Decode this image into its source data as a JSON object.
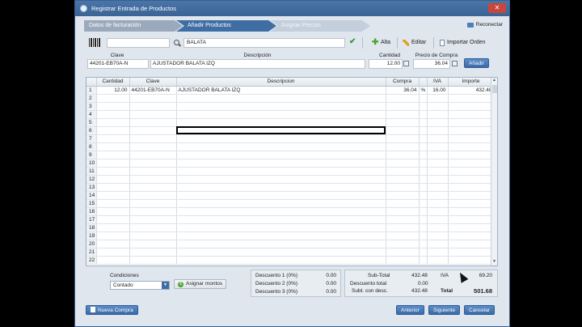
{
  "window": {
    "title": "Registrar Entrada de Productos",
    "close_label": "✕"
  },
  "wizard": {
    "steps": [
      "Datos de facturación",
      "Añadir Productos",
      "Asignar Precios"
    ],
    "active_step": 1,
    "reconnect_label": "Reconectar"
  },
  "toolbar": {
    "code_value": "",
    "search_value": "BALATA",
    "alta_label": "Alta",
    "editar_label": "Editar",
    "importar_label": "Importar Orden"
  },
  "entry": {
    "clave_label": "Clave",
    "clave_value": "44201-EB70A-N",
    "descripcion_label": "Descripción",
    "descripcion_value": "AJUSTADOR BALATA IZQ",
    "cantidad_label": "Cantidad",
    "cantidad_value": "12.00",
    "precio_label": "Precio de Compra",
    "precio_value": "36.04",
    "add_label": "Añadir"
  },
  "grid": {
    "columns": [
      "",
      "Cantidad",
      "Clave",
      "Descripcion",
      "Compra",
      "",
      "IVA",
      "Importe"
    ],
    "rows": [
      {
        "n": "1",
        "cantidad": "12.00",
        "clave": "44201-EB70A-N",
        "descripcion": "AJUSTADOR BALATA IZQ",
        "compra": "36.04",
        "pct": "%",
        "iva": "16.00",
        "importe": "432.48"
      }
    ],
    "empty_rows": [
      "2",
      "3",
      "4",
      "5",
      "6",
      "7",
      "8",
      "9",
      "10",
      "11",
      "12",
      "13",
      "14",
      "15",
      "16",
      "17",
      "18",
      "19",
      "20",
      "21",
      "22"
    ]
  },
  "conditions": {
    "label": "Condiciones",
    "value": "Contado",
    "assign_label": "Asignar montos"
  },
  "discounts": [
    {
      "label": "Descuento 1 (0%)",
      "value": "0.00"
    },
    {
      "label": "Descuento 2 (0%)",
      "value": "0.00"
    },
    {
      "label": "Descuento 3 (0%)",
      "value": "0.00"
    }
  ],
  "totals": {
    "subtotal_label": "Sub-Total",
    "subtotal_value": "432.48",
    "iva_label": "IVA",
    "iva_value": "69.20",
    "desc_total_label": "Descuento total",
    "desc_total_value": "0.00",
    "subt_desc_label": "Subt. con desc.",
    "subt_desc_value": "432.48",
    "total_label": "Total",
    "total_value": "501.68"
  },
  "footer": {
    "nueva_label": "Nueva Compra",
    "anterior_label": "Anterior",
    "siguiente_label": "Siguiente",
    "cancelar_label": "Cancelar"
  }
}
